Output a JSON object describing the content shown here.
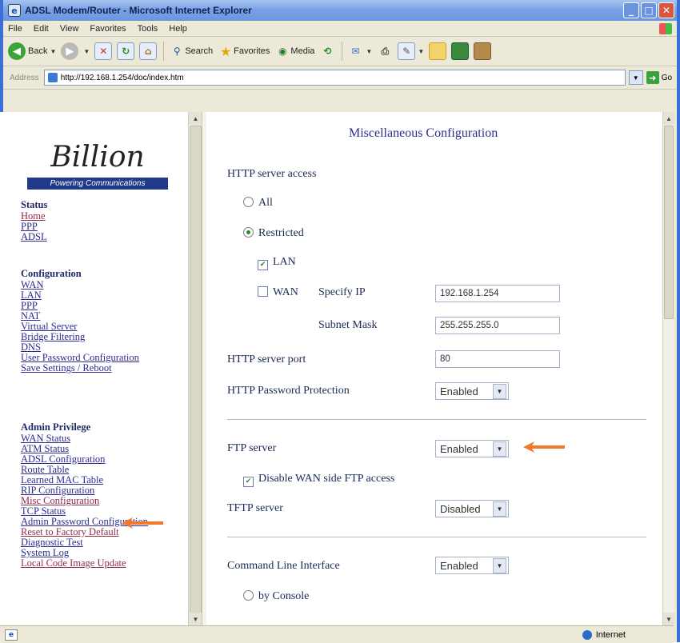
{
  "window": {
    "title": "ADSL Modem/Router - Microsoft Internet Explorer",
    "controls": [
      "_",
      "□",
      "✕"
    ]
  },
  "menu": [
    "File",
    "Edit",
    "View",
    "Favorites",
    "Tools",
    "Help"
  ],
  "toolbar": {
    "back": "Back",
    "search": "Search",
    "favorites": "Favorites",
    "media": "Media"
  },
  "address": {
    "label": "Address",
    "url": "http://192.168.1.254/doc/index.htm",
    "go": "Go"
  },
  "status": {
    "zone": "Internet"
  },
  "logo": {
    "brand": "Billion",
    "tagline": "Powering Communications"
  },
  "sidebar": {
    "sections": [
      {
        "heading": "Status",
        "links": [
          "Home",
          "PPP",
          "ADSL"
        ]
      },
      {
        "heading": "Configuration",
        "links": [
          "WAN",
          "LAN",
          "PPP",
          "NAT",
          "Virtual Server",
          "Bridge Filtering",
          "DNS",
          "User Password Configuration",
          "Save Settings / Reboot"
        ]
      },
      {
        "heading": "Admin Privilege",
        "links": [
          "WAN Status",
          "ATM Status",
          "ADSL Configuration",
          "Route Table",
          "Learned MAC Table",
          "RIP Configuration",
          "Misc Configuration",
          "TCP Status",
          "Admin Password Configuration",
          "Reset to Factory Default",
          "Diagnostic Test",
          "System Log",
          "Local Code Image Update"
        ]
      }
    ]
  },
  "content": {
    "title": "Miscellaneous Configuration",
    "http_access_label": "HTTP server access",
    "opt_all": "All",
    "opt_restricted": "Restricted",
    "chk_lan": "LAN",
    "chk_wan": "WAN",
    "specify_ip_label": "Specify IP",
    "specify_ip_value": "192.168.1.254",
    "subnet_label": "Subnet Mask",
    "subnet_value": "255.255.255.0",
    "http_port_label": "HTTP server port",
    "http_port_value": "80",
    "http_pw_label": "HTTP Password Protection",
    "http_pw_value": "Enabled",
    "ftp_label": "FTP server",
    "ftp_value": "Enabled",
    "disable_wan_ftp": "Disable WAN side FTP access",
    "tftp_label": "TFTP server",
    "tftp_value": "Disabled",
    "cli_label": "Command Line Interface",
    "cli_value": "Enabled",
    "by_console": "by Console"
  },
  "colors": {
    "accent_arrow": "#f07a2a",
    "link": "#2b2b8f",
    "title_bar": "#7aa3e6"
  }
}
